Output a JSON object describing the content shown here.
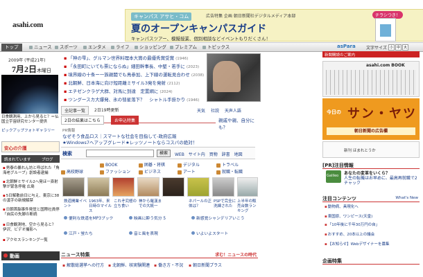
{
  "header": {
    "logo": "asahi.com",
    "ad": {
      "brand": "キャンパス アサヒ・コム",
      "sponsor": "広告特集 企画 朝日新聞社デジタルメディア本部",
      "headline": "夏のオープンキャンパスガイド",
      "sub": "キャンパスツアー、模擬授業、個別相談などイベントもりだくさん！",
      "bubble": "チラシつき！"
    }
  },
  "nav": {
    "tabs": [
      "トップ",
      "ニュース",
      "スポーツ",
      "エンタメ",
      "ライフ",
      "ショッピング",
      "プレミアム",
      "トピックス"
    ],
    "aspara": "asPara",
    "textsize": "文字サイズ"
  },
  "left": {
    "date_line": "2009年 (平成21年)",
    "date_main": "7月2日",
    "weekday": "木曜日",
    "photo_caption": "日食観測用、上から見ると？＝仏国立宇宙研究センター提供",
    "pickup": "ピックアップフォトギャラリー",
    "safety": "安心の介護",
    "tabs": [
      "読まれています",
      "ブログ"
    ],
    "news": [
      "男泰の暴れん坊と呼ばれた「角海老グループ」創設者逮捕",
      "北朝鮮ミサイル2ヘ発ほ一斉射撃が緊急停電 広島",
      "5日解散前日に与え、東京に38の漢字の新規解禁",
      "日朝首脳事件発覚と国際社員停 「自民の失脚の断続",
      "日食観測地、空から見ると？ 伊沢、ビデオ撮影へ",
      "アクセスランキング一覧"
    ],
    "douga": "動画"
  },
  "center": {
    "headlines": [
      {
        "text": "「神の雫」、グルマン世界料理本大賞の最優秀賞受賞",
        "time": "(1946)"
      },
      {
        "text": "「永田町にいても票にならぬ」細田幹事長、中堅・若手に",
        "time": "(2023)"
      },
      {
        "text": "境界線の十条ー一族親閥でも鳥参加、上下線の運転見合わせ",
        "time": "(2038)"
      },
      {
        "text": "北朝鮮、日本海に向け短距離ミサイル3発を発射",
        "time": "(2112)"
      },
      {
        "text": "エチゼンクラゲ大群、対馬に到達　定置網に",
        "time": "(2024)"
      },
      {
        "text": "ツングースカ大爆発、氷の彗星落下？　シャトル手掛かり",
        "time": "(1946)"
      }
    ],
    "more_btn": "全記事一覧",
    "updated": "2日19時更新",
    "cats": [
      "天気",
      "社説",
      "天声人語"
    ],
    "tabs": [
      "2日の結果はこちら",
      "お申込特集"
    ],
    "question": "親戚や親、自分にも？",
    "pr_label": "PR情報",
    "pr": [
      "なぜそう食品ロス｜スマートな社会を目指して-政府広報",
      "★Windows7へアップグレード★レッツノートならコスパの絶対！"
    ],
    "search": {
      "logo": "検索",
      "placeholder": "",
      "go": "検索",
      "scopes": [
        "WEB",
        "サイト内",
        "買物",
        "辞書",
        "地図"
      ]
    },
    "cat_rows": [
      [
        "BOOK",
        "囲碁・将棋",
        "デジタル",
        "トラベル",
        "愛車"
      ],
      [
        "ファッション",
        "ビジネス",
        "アート",
        "就職・転職"
      ],
      [
        "高校野球",
        "ファッション",
        "アート",
        "健康"
      ]
    ],
    "photo_caps": [
      "鉄道開業イベント",
      "1963年、来日時のマイルス",
      "これぞ究極の立ち食い",
      "神から羅漢までの大統一",
      "ネパールの正体は？",
      "PSPで完全に洗練された",
      "上半年の販売台数ランキング"
    ],
    "green_links": [
      "便利な鉄道をMP3ブック",
      "映画に酔う気分 5",
      "新感覚シャンデリアいこう",
      "いよいよスタート",
      "江戸・蛍たち",
      "音と風を表現"
    ],
    "news_special": {
      "title": "ニュース特集",
      "right": "求む！ニュースの時代"
    },
    "tokushu": [
      "解散総選挙への行方",
      "北朝鮮、核実験関連",
      "働き方・不況",
      "朝日新聞プラス"
    ]
  },
  "right": {
    "header": "新聞購読のご案内",
    "paper_logo": "asahi.com BOOK",
    "sanyatsu": {
      "small": "今日の",
      "big": "サン・ヤツ",
      "cap": "朝日新聞の広告欄"
    },
    "bookad": "新刊 ほまれとうか",
    "pr_section": "[PR]注目情報",
    "pr_item": {
      "badge": "Galileo",
      "title": "あなたの変革をいくら？",
      "desc": "人生の転機はお早めに、最高再就職で2チャック"
    },
    "attention": "注目コンテンツ",
    "attention_more": "What's New",
    "attention_items": [
      "動物病、具現化へ",
      "東国原、ワンピース(天皇)",
      "「10年後に千年30万円の自」",
      "おすすめ、20本以上の議会",
      "【お知らせ】Webデザイナーを募集"
    ],
    "kikaku": "企画特集"
  }
}
